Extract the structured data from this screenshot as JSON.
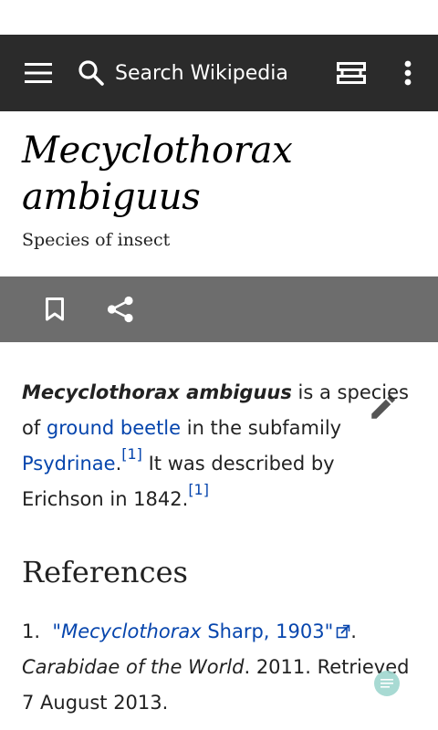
{
  "toolbar": {
    "search_placeholder": "Search Wikipedia",
    "background": "#2b2b2b",
    "icons": [
      "menu-icon",
      "search-icon",
      "tabs-icon",
      "overflow-icon"
    ]
  },
  "page": {
    "title_line1": "Mecyclothorax",
    "title_line2": "ambiguus",
    "description": "Species of insect"
  },
  "action_bar": {
    "background": "#6d6d6d",
    "icons": [
      "bookmark-icon",
      "share-icon"
    ]
  },
  "article": {
    "bold_name": "Mecyclothorax ambiguus",
    "text1": " is a species of ",
    "link1": "ground beetle",
    "text2": " in the subfamily ",
    "link2": "Psydrinae",
    "text3": ".",
    "cite1": "[1]",
    "text4": " It was described by Erichson in 1842.",
    "cite2": "[1]"
  },
  "references": {
    "heading": "References",
    "items": [
      {
        "number": "1.",
        "quote_open": "\"",
        "link_italic": "Mecyclothorax",
        "link_rest": " Sharp, 1903",
        "quote_close": "\"",
        "after_link": ".",
        "work": "Carabidae of the World",
        "tail1": ". 2011. Retrieved",
        "tail2": "7 August 2013."
      }
    ]
  },
  "colors": {
    "link": "#0645ad",
    "toc_button": "#9fd6cf"
  }
}
